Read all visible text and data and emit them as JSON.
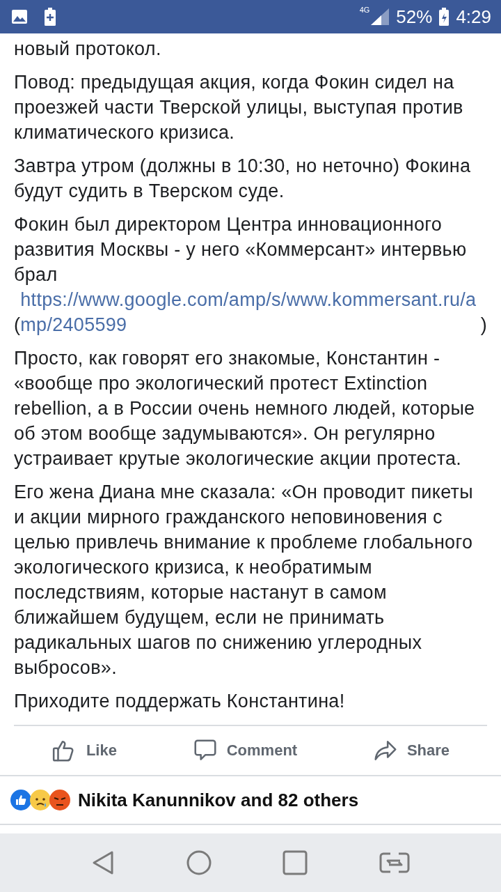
{
  "status_bar": {
    "network": "4G",
    "battery": "52%",
    "time": "4:29"
  },
  "post": {
    "paragraphs": [
      {
        "parts": [
          {
            "kind": "text",
            "text": "новый протокол."
          }
        ]
      },
      {
        "parts": [
          {
            "kind": "text",
            "text": "Повод: предыдущая акция, когда Фокин сидел на проезжей части Тверской улицы, выступая против климатического кризиса."
          }
        ]
      },
      {
        "parts": [
          {
            "kind": "text",
            "text": "Завтра утром (должны в 10:30, но неточно) Фокина будут судить в Тверском суде."
          }
        ]
      },
      {
        "parts": [
          {
            "kind": "text",
            "text": "Фокин был директором Центра инновационного развития Москвы - у него «Коммерсант» интервью брал"
          },
          {
            "kind": "text",
            "text": "("
          },
          {
            "kind": "link",
            "text": "https://www.google.com/amp/s/www.kommersant.ru/amp/2405599"
          },
          {
            "kind": "text",
            "text": ")"
          }
        ]
      },
      {
        "parts": [
          {
            "kind": "text",
            "text": "Просто, как говорят его знакомые, Константин - «вообще про экологический протест Extinction rebellion, а в России очень немного людей, которые об этом вообще задумываются». Он регулярно устраивает крутые экологические акции протеста."
          }
        ]
      },
      {
        "parts": [
          {
            "kind": "text",
            "text": "Его жена Диана мне сказала: «Он проводит пикеты и акции мирного гражданского неповиновения с целью привлечь внимание к проблеме глобального экологического кризиса, к необратимым последствиям, которые настанут в самом ближайшем будущем, если не принимать радикальных шагов по снижению углеродных выбросов»."
          }
        ]
      },
      {
        "parts": [
          {
            "kind": "text",
            "text": "Приходите поддержать Константина!"
          }
        ]
      }
    ]
  },
  "actions": [
    {
      "kind": "like",
      "label": "Like"
    },
    {
      "kind": "comment",
      "label": "Comment"
    },
    {
      "kind": "share",
      "label": "Share"
    }
  ],
  "reactions": {
    "icons": [
      {
        "kind": "like"
      },
      {
        "kind": "sad"
      },
      {
        "kind": "angry"
      }
    ],
    "text": "Nikita Kanunnikov and 82 others"
  }
}
